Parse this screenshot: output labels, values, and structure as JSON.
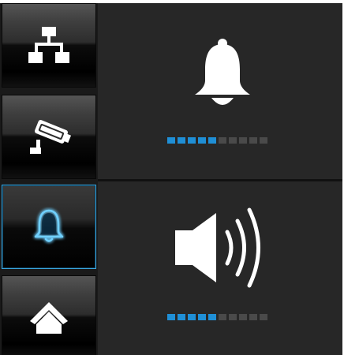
{
  "sidebar": {
    "items": [
      {
        "icon": "network-icon",
        "active": false
      },
      {
        "icon": "security-camera-icon",
        "active": false
      },
      {
        "icon": "bell-icon",
        "active": true
      },
      {
        "icon": "home-icon",
        "active": false
      }
    ]
  },
  "panels": {
    "notification": {
      "icon": "bell-icon",
      "level": {
        "filled": 5,
        "total": 10
      }
    },
    "volume": {
      "icon": "speaker-volume-icon",
      "level": {
        "filled": 5,
        "total": 10
      }
    }
  },
  "colors": {
    "accent": "#1f8fd6",
    "active_border": "#3aa6e0",
    "segment_off": "#4a4a4a",
    "background": "#272727",
    "icon": "#ffffff"
  }
}
